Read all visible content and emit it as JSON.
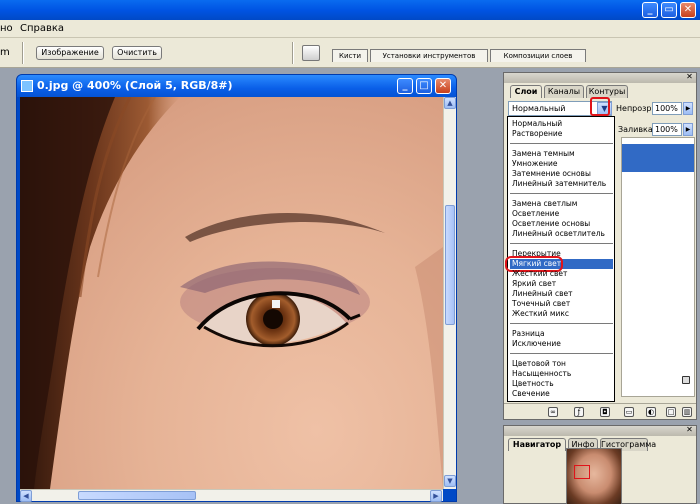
{
  "menubar": {
    "left_item": "но",
    "help": "Справка"
  },
  "options": {
    "left_label": "m",
    "image_button": "Изображение",
    "clear_button": "Очистить",
    "well_tabs": [
      "Кисти",
      "Установки инструментов",
      "Композиции слоев"
    ]
  },
  "document": {
    "title": "0.jpg @ 400% (Слой 5, RGB/8#)"
  },
  "layers_palette": {
    "tabs": [
      "Слои",
      "Каналы",
      "Контуры"
    ],
    "blend_mode": "Нормальный",
    "opacity_label": "Непрозр.:",
    "opacity_value": "100%",
    "fill_label": "Заливка:",
    "fill_value": "100%"
  },
  "blend_groups": [
    [
      "Нормальный",
      "Растворение"
    ],
    [
      "Замена темным",
      "Умножение",
      "Затемнение основы",
      "Линейный затемнитель"
    ],
    [
      "Замена светлым",
      "Осветление",
      "Осветление основы",
      "Линейный осветлитель"
    ],
    [
      "Перекрытие",
      "Мягкий свет",
      "Жесткий свет",
      "Яркий свет",
      "Линейный свет",
      "Точечный свет",
      "Жесткий микс"
    ],
    [
      "Разница",
      "Исключение"
    ],
    [
      "Цветовой тон",
      "Насыщенность",
      "Цветность",
      "Свечение"
    ]
  ],
  "selected_blend": "Мягкий свет",
  "navigator": {
    "tabs": [
      "Навигатор",
      "Инфо",
      "Гистограмма"
    ]
  },
  "colors": {
    "highlight": "#316ac5",
    "callout": "#e0141a",
    "xp_blue": "#0054e3"
  }
}
